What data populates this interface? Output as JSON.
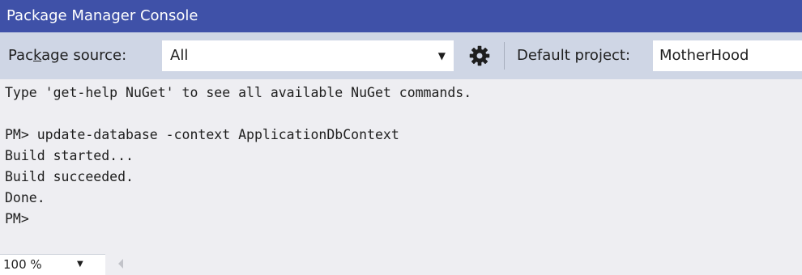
{
  "window": {
    "title": "Package Manager Console"
  },
  "toolbar": {
    "package_source_label_pre": "Pac",
    "package_source_label_acc": "k",
    "package_source_label_post": "age source:",
    "package_source_value": "All",
    "settings_icon": "gear-icon",
    "default_project_label_pre": "Default pro",
    "default_project_label_acc": "j",
    "default_project_label_post": "ect:",
    "default_project_value": "MotherHood"
  },
  "console": {
    "lines": [
      "Type 'get-help NuGet' to see all available NuGet commands.",
      "",
      "PM> update-database -context ApplicationDbContext",
      "Build started...",
      "Build succeeded.",
      "Done.",
      "PM>"
    ]
  },
  "statusbar": {
    "zoom_value": "100 %"
  },
  "colors": {
    "titlebar": "#3f51a8",
    "toolbar": "#cfd6e5",
    "console_bg": "#eeeef2",
    "text": "#1e1e1e"
  }
}
